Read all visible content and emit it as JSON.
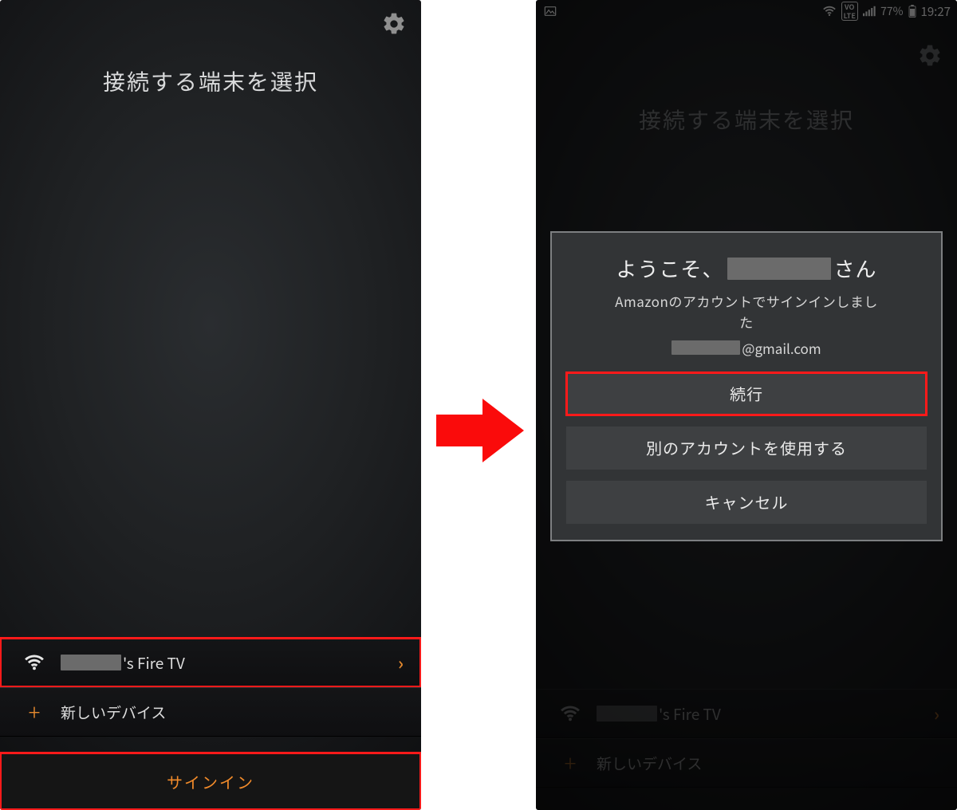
{
  "left": {
    "title": "接続する端末を選択",
    "device_suffix": "'s Fire TV",
    "new_device": "新しいデバイス",
    "signin": "サインイン"
  },
  "right": {
    "status": {
      "battery": "77%",
      "time": "19:27",
      "volte_top": "VO",
      "volte_bot": "LTE"
    },
    "title": "接続する端末を選択",
    "dialog": {
      "welcome_prefix": "ようこそ、",
      "welcome_suffix": "さん",
      "sub1": "Amazonのアカウントでサインインしまし",
      "sub2": "た",
      "email_suffix": "@gmail.com",
      "continue": "続行",
      "other_account": "別のアカウントを使用する",
      "cancel": "キャンセル"
    },
    "device_suffix": "'s Fire TV",
    "new_device": "新しいデバイス"
  }
}
